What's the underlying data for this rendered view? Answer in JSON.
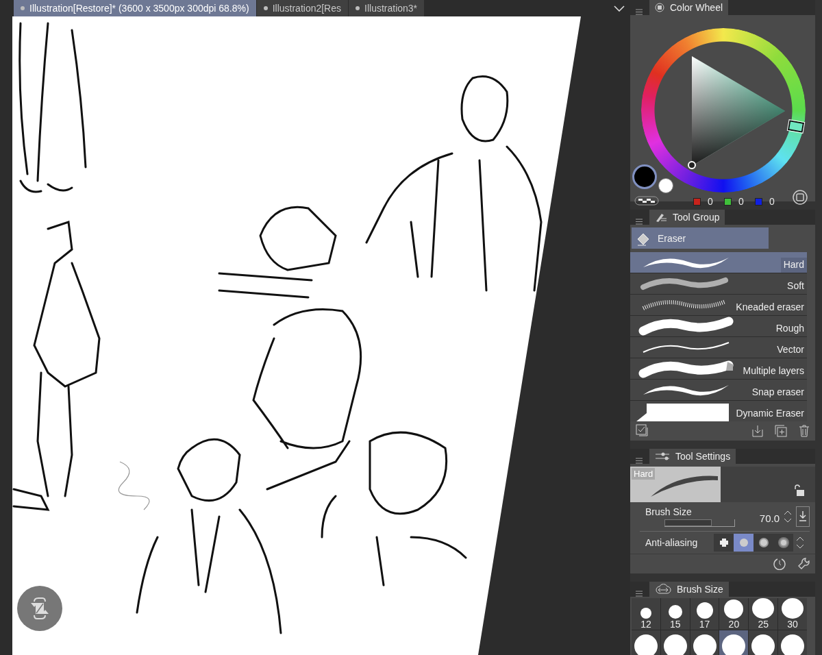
{
  "tabs": [
    {
      "label": "Illustration[Restore]* (3600 x 3500px 300dpi 68.8%)",
      "selected": true
    },
    {
      "label": "Illustration2[Res",
      "selected": false
    },
    {
      "label": "Illustration3*",
      "selected": false
    }
  ],
  "color_wheel": {
    "title": "Color Wheel",
    "channels": [
      {
        "color": "#c8231c",
        "value": "0"
      },
      {
        "color": "#3fbf3a",
        "value": "0"
      },
      {
        "color": "#1020e0",
        "value": "0"
      }
    ]
  },
  "tool_group": {
    "title": "Tool Group",
    "tool": "Eraser",
    "subtools": [
      {
        "label": "Hard",
        "kind": "taper",
        "selected": true
      },
      {
        "label": "Soft",
        "kind": "soft",
        "selected": false
      },
      {
        "label": "Kneaded eraser",
        "kind": "grainy",
        "selected": false
      },
      {
        "label": "Rough",
        "kind": "thick",
        "selected": false
      },
      {
        "label": "Vector",
        "kind": "thin",
        "selected": false
      },
      {
        "label": "Multiple layers",
        "kind": "layered",
        "selected": false
      },
      {
        "label": "Snap eraser",
        "kind": "taper",
        "selected": false
      },
      {
        "label": "Dynamic Eraser",
        "kind": "block",
        "selected": false
      }
    ]
  },
  "tool_settings": {
    "title": "Tool Settings",
    "preview_label": "Hard",
    "brush_size": {
      "label": "Brush Size",
      "value": "70.0",
      "level": 0.66
    },
    "anti_aliasing": {
      "label": "Anti-aliasing",
      "options": [
        {
          "selected": false
        },
        {
          "selected": true
        },
        {
          "selected": false
        },
        {
          "selected": false
        }
      ]
    }
  },
  "brush_size_palette": {
    "title": "Brush Size",
    "sizes": [
      {
        "label": "12",
        "selected": false
      },
      {
        "label": "15",
        "selected": false
      },
      {
        "label": "17",
        "selected": false
      },
      {
        "label": "20",
        "selected": false
      },
      {
        "label": "25",
        "selected": false
      },
      {
        "label": "30",
        "selected": false
      }
    ],
    "next_row": [
      {
        "selected": false
      },
      {
        "selected": false
      },
      {
        "selected": false
      },
      {
        "selected": true
      },
      {
        "selected": false
      },
      {
        "selected": false
      }
    ]
  }
}
